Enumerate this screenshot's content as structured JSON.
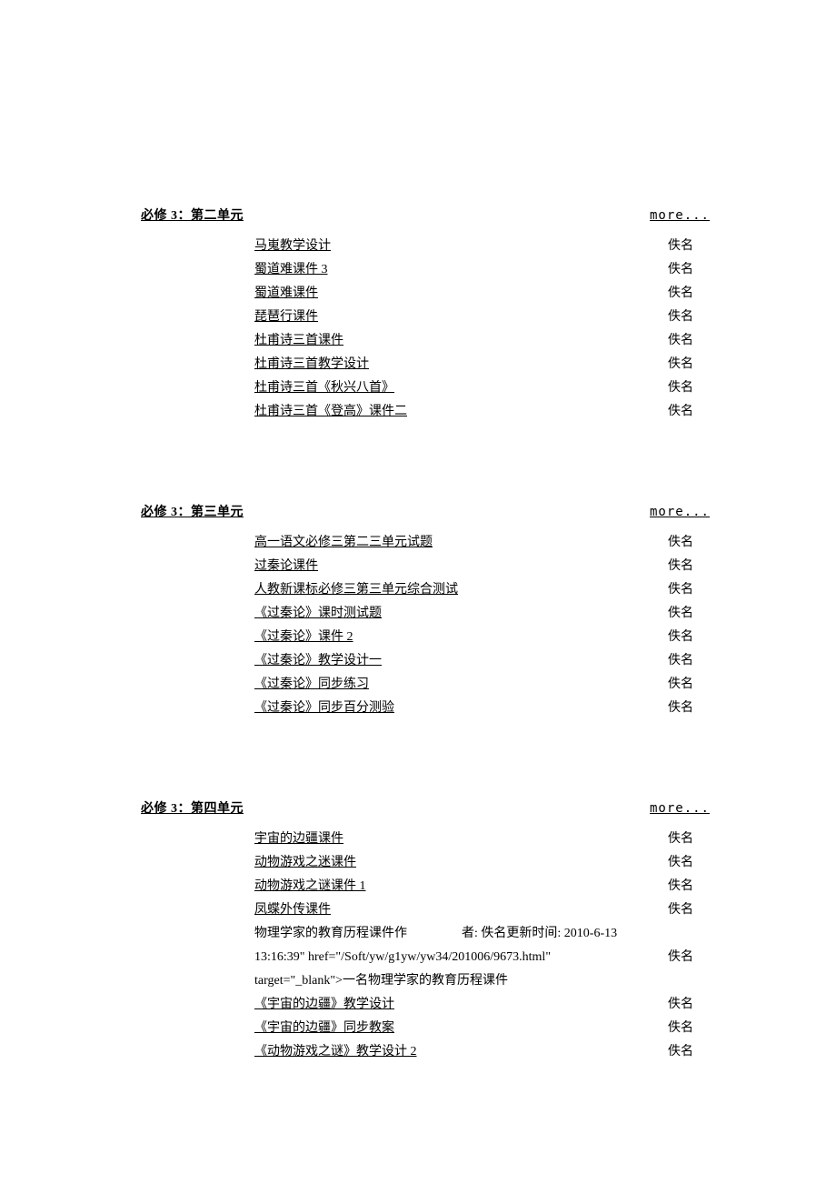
{
  "sections": [
    {
      "title": "必修 3：第二单元",
      "more": "more...",
      "items": [
        {
          "title": "马嵬教学设计",
          "author": "佚名"
        },
        {
          "title": "蜀道难课件 3",
          "author": "佚名"
        },
        {
          "title": "蜀道难课件",
          "author": "佚名"
        },
        {
          "title": "琵琶行课件",
          "author": "佚名"
        },
        {
          "title": "杜甫诗三首课件",
          "author": "佚名"
        },
        {
          "title": "杜甫诗三首教学设计",
          "author": "佚名"
        },
        {
          "title": "杜甫诗三首《秋兴八首》",
          "author": "佚名"
        },
        {
          "title": "杜甫诗三首《登高》课件二",
          "author": "佚名"
        }
      ]
    },
    {
      "title": "必修 3：第三单元",
      "more": "more...",
      "items": [
        {
          "title": "高一语文必修三第二三单元试题",
          "author": "佚名"
        },
        {
          "title": "过秦论课件",
          "author": "佚名"
        },
        {
          "title": "人教新课标必修三第三单元综合测试",
          "author": "佚名"
        },
        {
          "title": "《过秦论》课时测试题",
          "author": "佚名"
        },
        {
          "title": "《过秦论》课件 2",
          "author": "佚名"
        },
        {
          "title": "《过秦论》教学设计一",
          "author": "佚名"
        },
        {
          "title": "《过秦论》同步练习",
          "author": "佚名"
        },
        {
          "title": "《过秦论》同步百分测验",
          "author": "佚名"
        }
      ]
    },
    {
      "title": "必修 3：第四单元",
      "more": "more...",
      "items": [
        {
          "title": "宇宙的边疆课件",
          "author": "佚名"
        },
        {
          "title": "动物游戏之迷课件",
          "author": "佚名"
        },
        {
          "title": "动物游戏之谜课件 1",
          "author": "佚名"
        },
        {
          "title": "凤蝶外传课件",
          "author": "佚名"
        }
      ],
      "broken": {
        "line1_left": "物理学家的教育历程课件作",
        "line1_right": "者: 佚名更新时间: 2010-6-13",
        "line2": "13:16:39\" href=\"/Soft/yw/g1yw/yw34/201006/9673.html\"",
        "line3": "target=\"_blank\">一名物理学家的教育历程课件",
        "author": "佚名"
      },
      "items_after": [
        {
          "title": "《宇宙的边疆》教学设计",
          "author": "佚名"
        },
        {
          "title": "《宇宙的边疆》同步教案",
          "author": "佚名"
        },
        {
          "title": "《动物游戏之谜》教学设计 2",
          "author": "佚名"
        }
      ]
    }
  ]
}
